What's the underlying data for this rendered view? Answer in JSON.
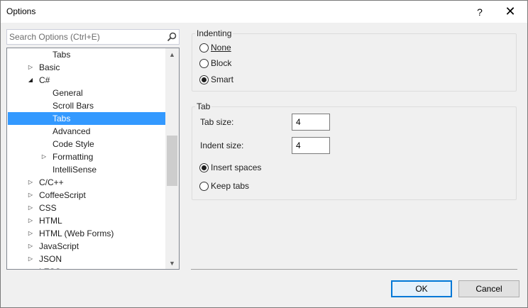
{
  "window": {
    "title": "Options",
    "help_glyph": "?",
    "close_glyph": "✕"
  },
  "search": {
    "placeholder": "Search Options (Ctrl+E)",
    "icon": "search-icon"
  },
  "tree": {
    "items": [
      {
        "label": "Tabs",
        "expander": "",
        "selected": false
      },
      {
        "label": "Basic",
        "expander": "▷",
        "selected": false
      },
      {
        "label": "C#",
        "expander": "◢",
        "selected": false
      },
      {
        "label": "General",
        "expander": "",
        "selected": false
      },
      {
        "label": "Scroll Bars",
        "expander": "",
        "selected": false
      },
      {
        "label": "Tabs",
        "expander": "",
        "selected": true
      },
      {
        "label": "Advanced",
        "expander": "",
        "selected": false
      },
      {
        "label": "Code Style",
        "expander": "",
        "selected": false
      },
      {
        "label": "Formatting",
        "expander": "▷",
        "selected": false
      },
      {
        "label": "IntelliSense",
        "expander": "",
        "selected": false
      },
      {
        "label": "C/C++",
        "expander": "▷",
        "selected": false
      },
      {
        "label": "CoffeeScript",
        "expander": "▷",
        "selected": false
      },
      {
        "label": "CSS",
        "expander": "▷",
        "selected": false
      },
      {
        "label": "HTML",
        "expander": "▷",
        "selected": false
      },
      {
        "label": "HTML (Web Forms)",
        "expander": "▷",
        "selected": false
      },
      {
        "label": "JavaScript",
        "expander": "▷",
        "selected": false
      },
      {
        "label": "JSON",
        "expander": "▷",
        "selected": false
      },
      {
        "label": "LESS",
        "expander": "▷",
        "selected": false
      }
    ],
    "scroll_up": "▲",
    "scroll_down": "▼"
  },
  "indenting": {
    "title": "Indenting",
    "options": [
      {
        "label": "None",
        "checked": false
      },
      {
        "label": "Block",
        "checked": false
      },
      {
        "label": "Smart",
        "checked": true
      }
    ]
  },
  "tab": {
    "title": "Tab",
    "tab_size_label": "Tab size:",
    "tab_size_value": "4",
    "indent_size_label": "Indent size:",
    "indent_size_value": "4",
    "insert_spaces_label": "Insert spaces",
    "insert_spaces_checked": true,
    "keep_tabs_label": "Keep tabs",
    "keep_tabs_checked": false
  },
  "buttons": {
    "ok": "OK",
    "cancel": "Cancel"
  }
}
